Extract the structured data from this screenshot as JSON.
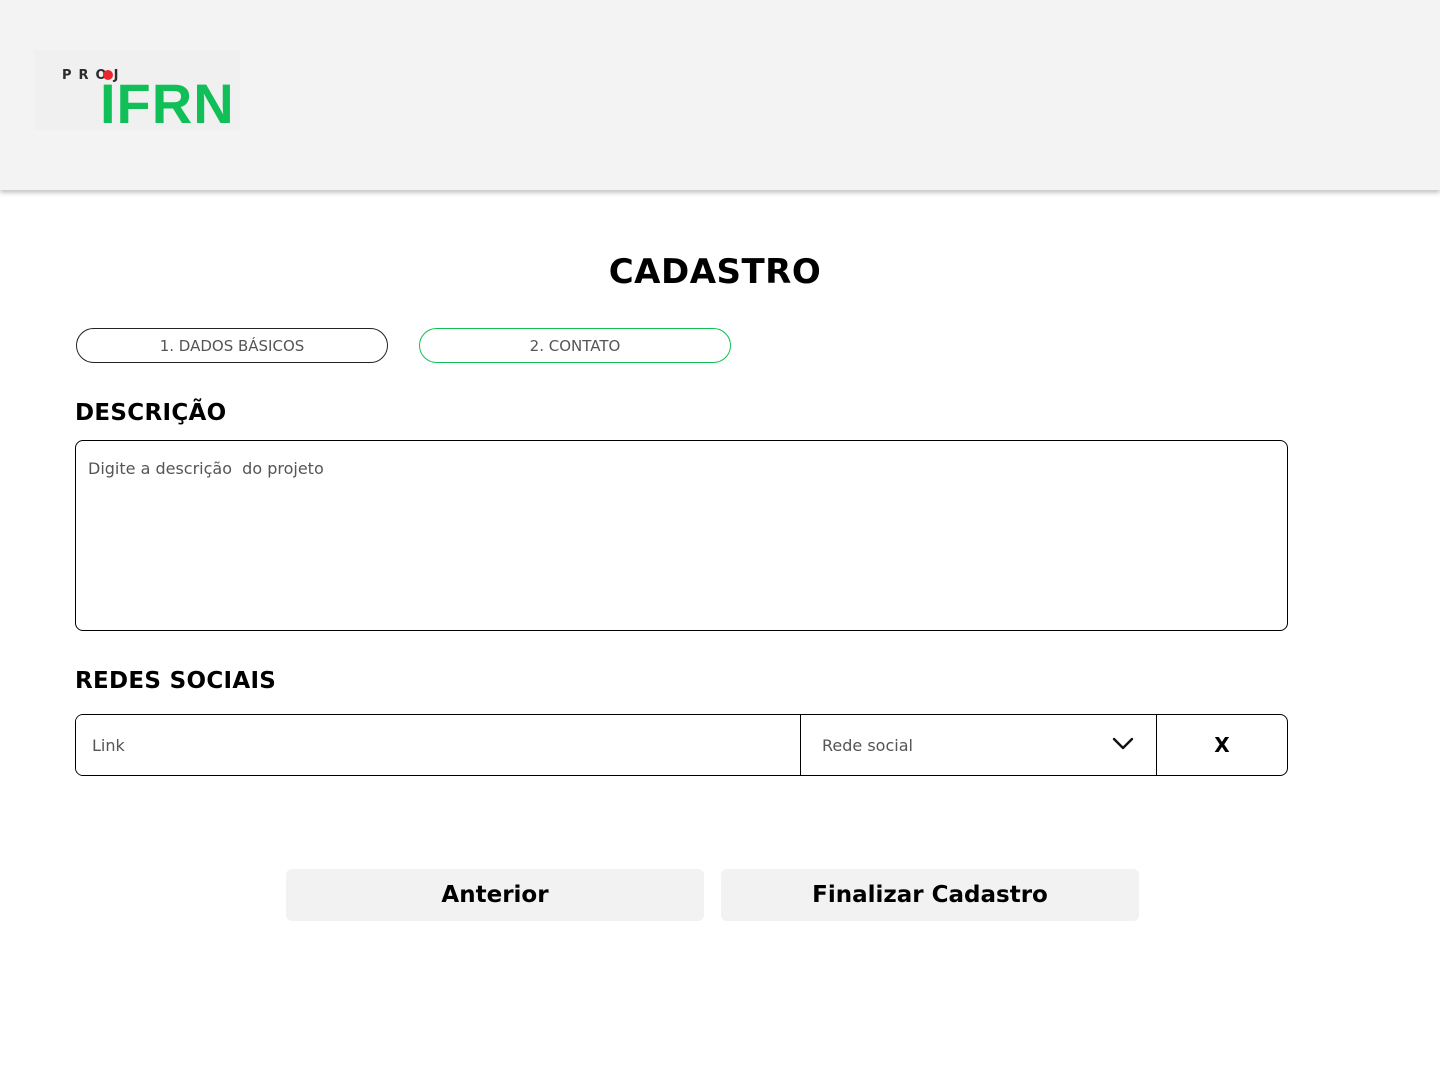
{
  "logo": {
    "small_text": "PROJ",
    "main_text": "IFRN"
  },
  "page": {
    "title": "CADASTRO"
  },
  "steps": [
    {
      "label": "1. DADOS BÁSICOS",
      "active": false
    },
    {
      "label": "2. CONTATO",
      "active": true
    }
  ],
  "description": {
    "label": "DESCRIÇÃO",
    "placeholder": "Digite a descrição  do projeto",
    "value": ""
  },
  "social": {
    "label": "REDES SOCIAIS",
    "link_placeholder": "Link",
    "network_select": "Rede social",
    "remove_label": "X"
  },
  "actions": {
    "previous_label": "Anterior",
    "finish_label": "Finalizar Cadastro"
  },
  "colors": {
    "brand_green": "#10bf57",
    "brand_red": "#e8262b",
    "header_bg": "#f3f3f3",
    "button_bg": "#f2f2f2"
  }
}
